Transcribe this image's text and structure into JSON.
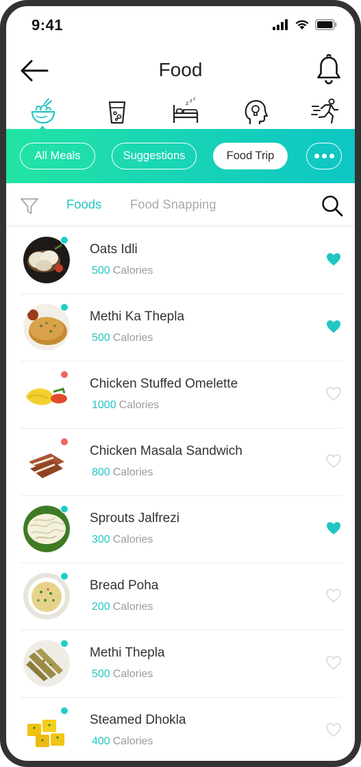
{
  "status_bar": {
    "time": "9:41"
  },
  "header": {
    "title": "Food"
  },
  "categories": [
    {
      "name": "food",
      "active": true
    },
    {
      "name": "water",
      "active": false
    },
    {
      "name": "sleep",
      "active": false
    },
    {
      "name": "mind",
      "active": false
    },
    {
      "name": "activity",
      "active": false
    }
  ],
  "chips": [
    {
      "label": "All Meals",
      "active": false
    },
    {
      "label": "Suggestions",
      "active": false
    },
    {
      "label": "Food Trip",
      "active": true
    }
  ],
  "subtabs": {
    "foods": "Foods",
    "food_snapping": "Food Snapping",
    "active": "foods"
  },
  "calories_unit": "Calories",
  "foods": [
    {
      "name": "Oats Idli",
      "calories": "500",
      "favorite": true,
      "dot": "teal"
    },
    {
      "name": "Methi Ka Thepla",
      "calories": "500",
      "favorite": true,
      "dot": "teal"
    },
    {
      "name": "Chicken Stuffed Omelette",
      "calories": "1000",
      "favorite": false,
      "dot": "red"
    },
    {
      "name": "Chicken Masala Sandwich",
      "calories": "800",
      "favorite": false,
      "dot": "red"
    },
    {
      "name": "Sprouts Jalfrezi",
      "calories": "300",
      "favorite": true,
      "dot": "teal"
    },
    {
      "name": "Bread Poha",
      "calories": "200",
      "favorite": false,
      "dot": "teal"
    },
    {
      "name": "Methi Thepla",
      "calories": "500",
      "favorite": false,
      "dot": "teal"
    },
    {
      "name": "Steamed Dhokla",
      "calories": "400",
      "favorite": false,
      "dot": "teal"
    }
  ],
  "colors": {
    "accent": "#21c5c3",
    "veg_dot": "#1fcfc6",
    "nonveg_dot": "#f0655e",
    "band_start": "#22e4a4",
    "band_end": "#0dc6c4"
  }
}
